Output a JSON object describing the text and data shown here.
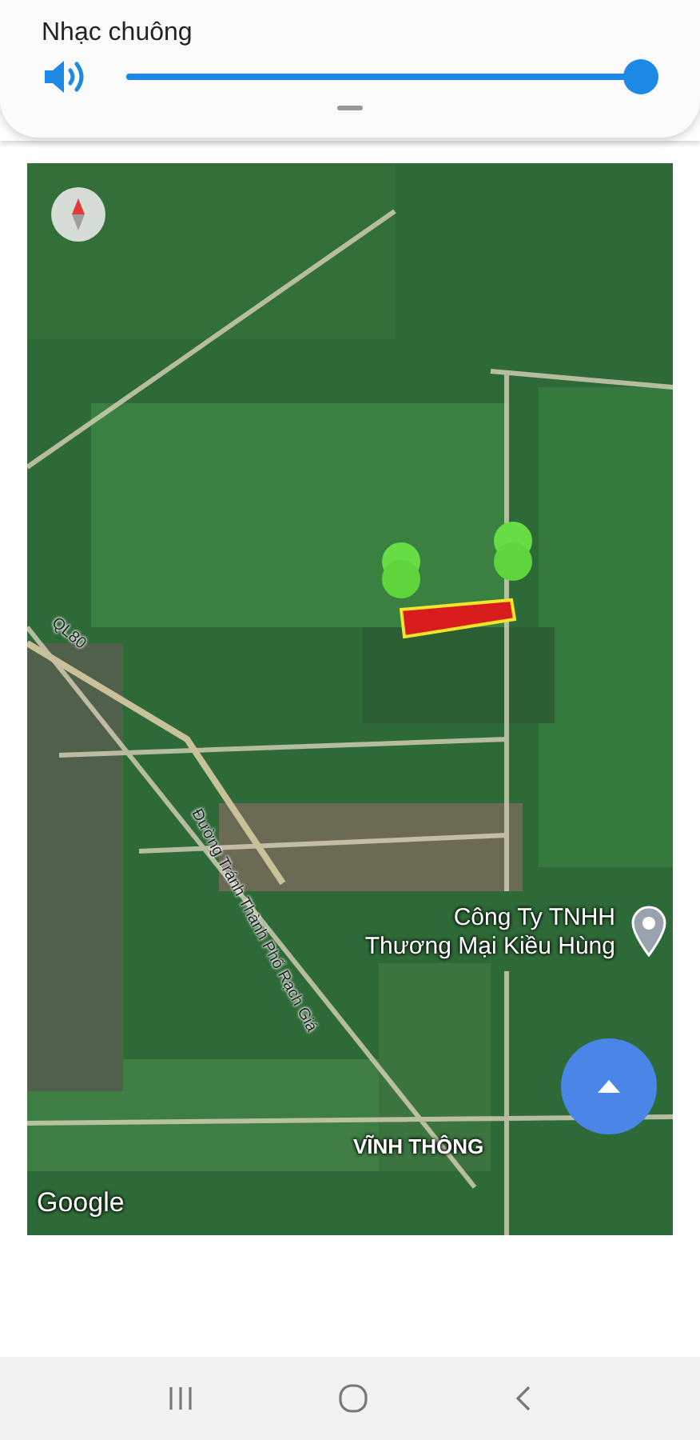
{
  "volume_panel": {
    "label": "Nhạc chuông",
    "level": 1
  },
  "map": {
    "labels": [
      {
        "kind": "poi",
        "text": "Công Ty TNHH\nThương Mại Kiều Hùng"
      },
      {
        "kind": "area",
        "text": "VĨNH THÔNG"
      },
      {
        "kind": "road",
        "text": "QL80"
      },
      {
        "kind": "road",
        "text": "Đường Tránh Thành Phố Rạch Giá"
      }
    ],
    "attribution": "Google"
  }
}
